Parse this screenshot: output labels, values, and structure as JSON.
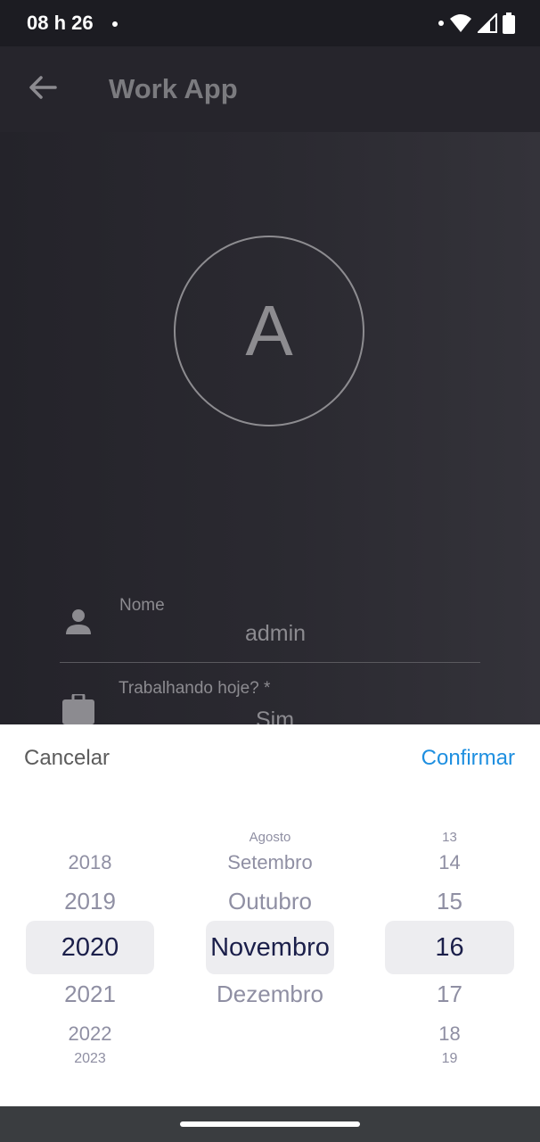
{
  "status_bar": {
    "time": "08 h 26",
    "icons": [
      "notification-dot-icon",
      "wifi-icon",
      "signal-icon",
      "battery-icon"
    ]
  },
  "app_bar": {
    "title": "Work App",
    "back_icon": "arrow-left-icon"
  },
  "profile": {
    "avatar_letter": "A",
    "fields": [
      {
        "icon": "person-icon",
        "label": "Nome",
        "value": "admin"
      },
      {
        "icon": "briefcase-icon",
        "label": "Trabalhando hoje? *",
        "value": "Sim"
      }
    ]
  },
  "date_picker": {
    "cancel_label": "Cancelar",
    "confirm_label": "Confirmar",
    "years": [
      "2018",
      "2019",
      "2020",
      "2021",
      "2022",
      "2023"
    ],
    "months": [
      "Agosto",
      "Setembro",
      "Outubro",
      "Novembro",
      "Dezembro"
    ],
    "days": [
      "13",
      "14",
      "15",
      "16",
      "17",
      "18",
      "19"
    ],
    "selected": {
      "year": "2020",
      "month": "Novembro",
      "day": "16"
    }
  },
  "colors": {
    "accent": "#1e8fe0",
    "selected_text": "#1b1f4a",
    "picker_text": "#8f8fa3"
  }
}
